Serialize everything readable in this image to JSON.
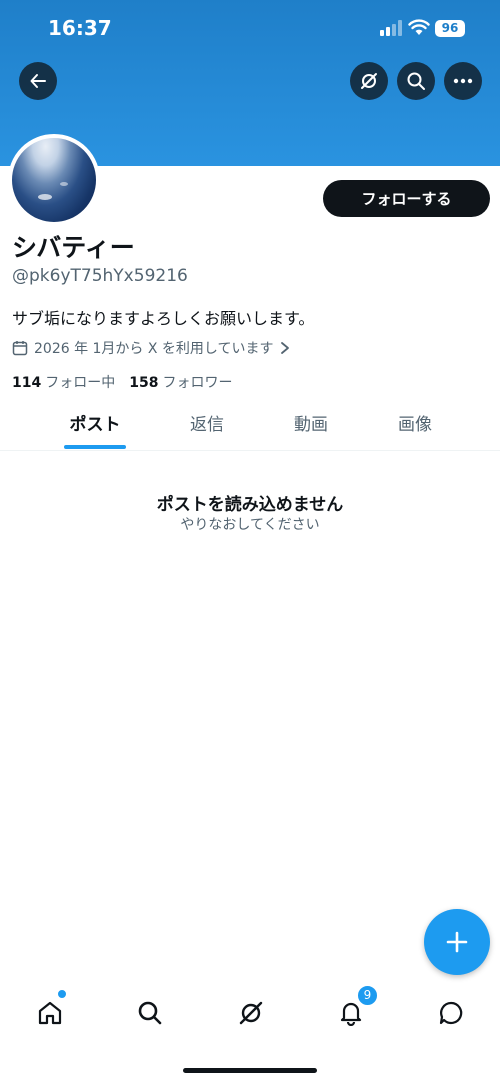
{
  "status_bar": {
    "time": "16:37",
    "battery": "96"
  },
  "profile": {
    "display_name": "シバティー",
    "handle": "@pk6yT75hYx59216",
    "bio": "サブ垢になりますよろしくお願いします。",
    "joined": "2026 年 1月から X を利用しています",
    "following_count": "114",
    "following_label": "フォロー中",
    "followers_count": "158",
    "followers_label": "フォロワー",
    "follow_button": "フォローする"
  },
  "tabs": [
    {
      "label": "ポスト",
      "active": true
    },
    {
      "label": "返信",
      "active": false
    },
    {
      "label": "動画",
      "active": false
    },
    {
      "label": "画像",
      "active": false
    }
  ],
  "empty_state": {
    "title": "ポストを読み込めません",
    "subtitle": "やりなおしてください"
  },
  "bottom_nav": {
    "notification_badge": "9"
  },
  "colors": {
    "accent": "#1d9bf0",
    "banner": "#2a93e0",
    "text_primary": "#0f1419",
    "text_secondary": "#536471"
  }
}
